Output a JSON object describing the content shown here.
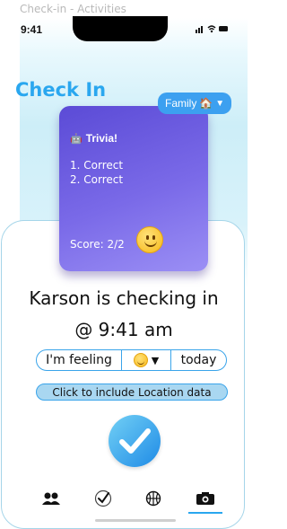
{
  "window": {
    "title": "Check-in - Activities"
  },
  "status_bar": {
    "time": "9:41",
    "icons": "..ıl ᯤ ▬"
  },
  "header": {
    "title": "Check In",
    "family_label": "Family",
    "family_icon": "house-icon"
  },
  "trivia": {
    "title": "Trivia!",
    "title_icon": "robot-icon",
    "answers": [
      "1. Correct",
      "2. Correct"
    ],
    "score": "Score: 2/2"
  },
  "checkin": {
    "line1": "Karson is checking in",
    "line2": "@ 9:41 am"
  },
  "feeling": {
    "prefix": "I'm feeling",
    "mood_icon": "smiley-icon",
    "suffix": "today"
  },
  "location_button": {
    "label": "Click to include Location data"
  },
  "tabs": [
    {
      "name": "people",
      "glyph": "👥"
    },
    {
      "name": "check",
      "glyph": "✓"
    },
    {
      "name": "basketball",
      "glyph": "🏀"
    },
    {
      "name": "camera",
      "glyph": "📷"
    }
  ],
  "colors": {
    "accent": "#2aa7ef",
    "card": "#6a5ae0"
  }
}
